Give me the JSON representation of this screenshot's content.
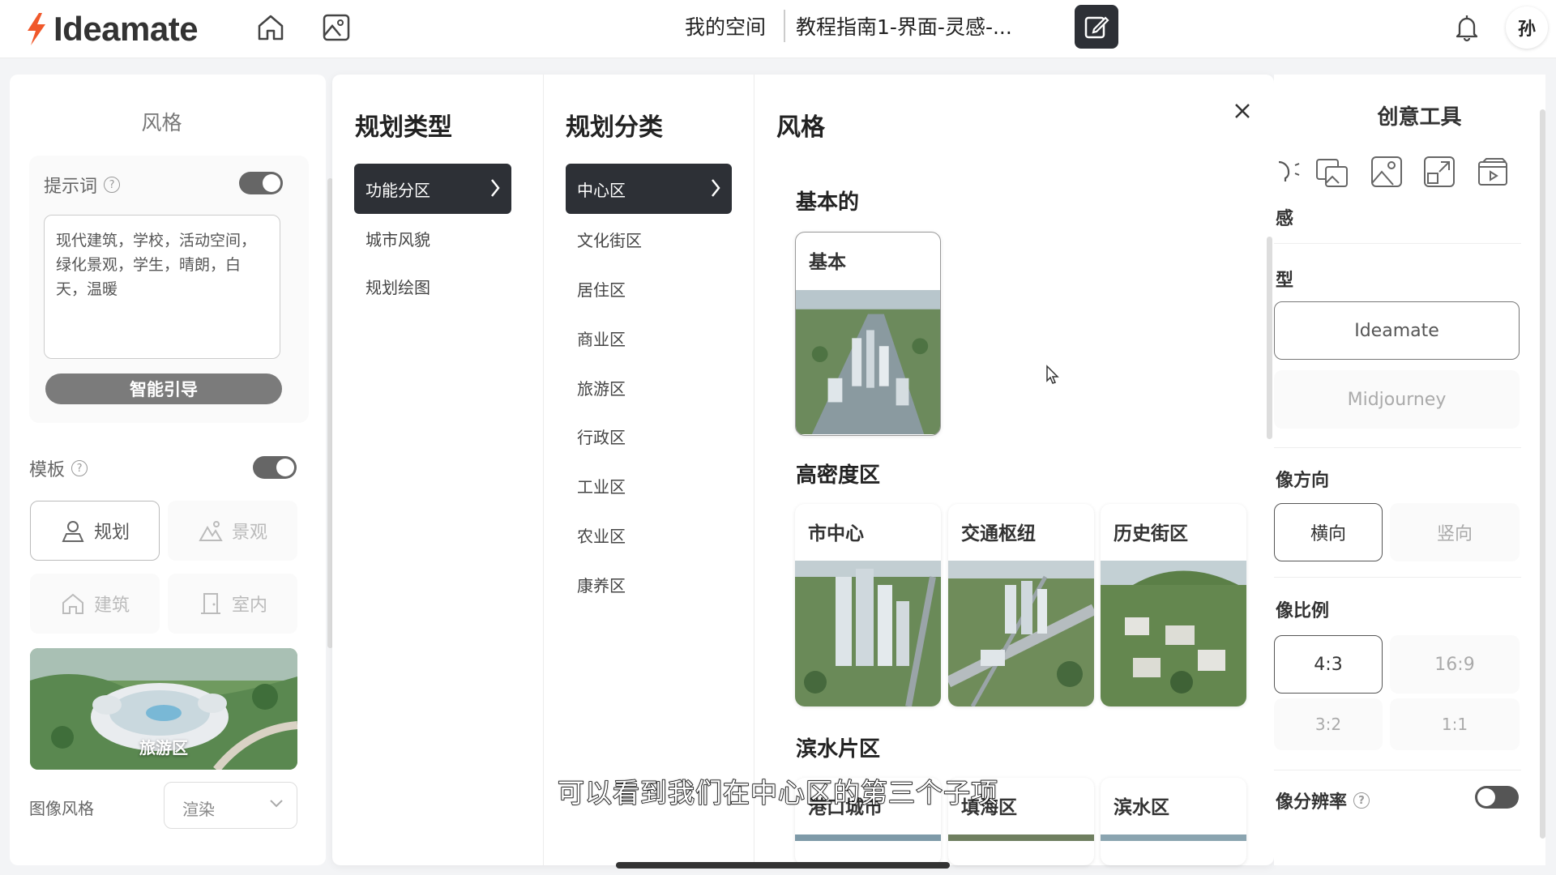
{
  "app": {
    "logo_text": "Ideamate"
  },
  "header": {
    "crumb_space": "我的空间",
    "crumb_title": "教程指南1-界面-灵感-...",
    "avatar_initial": "孙"
  },
  "left_panel": {
    "title": "风格",
    "prompt_label": "提示词",
    "prompt_text": "现代建筑，学校，活动空间，绿化景观，学生，晴朗，白天，温暖",
    "guide_button": "智能引导",
    "template_label": "模板",
    "template_buttons": [
      "规划",
      "景观",
      "建筑",
      "室内"
    ],
    "template_image_label": "旅游区",
    "image_style_label": "图像风格",
    "image_style_value": "渲染"
  },
  "popup": {
    "col1_title": "规划类型",
    "col1_items": [
      "功能分区",
      "城市风貌",
      "规划绘图"
    ],
    "col2_title": "规划分类",
    "col2_items": [
      "中心区",
      "文化街区",
      "居住区",
      "商业区",
      "旅游区",
      "行政区",
      "工业区",
      "农业区",
      "康养区"
    ],
    "col3_title": "风格",
    "groups": [
      {
        "title": "基本的",
        "cards": [
          "基本"
        ]
      },
      {
        "title": "高密度区",
        "cards": [
          "市中心",
          "交通枢纽",
          "历史街区"
        ]
      },
      {
        "title": "滨水片区",
        "cards": [
          "港口城市",
          "填海区",
          "滨水区"
        ]
      }
    ]
  },
  "right_panel": {
    "title": "创意工具",
    "tool_caption": "感",
    "model_label": "型",
    "models": [
      "Ideamate",
      "Midjourney"
    ],
    "orientation_label": "像方向",
    "orientations": [
      "横向",
      "竖向"
    ],
    "ratio_label": "像比例",
    "ratios": [
      "4:3",
      "16:9",
      "3:2",
      "1:1"
    ],
    "resolution_label": "像分辨率"
  },
  "subtitle": "可以看到我们在中心区的第三个子项",
  "colors": {
    "accent_dark": "#2d3036",
    "logo_orange": "#f0582a"
  }
}
